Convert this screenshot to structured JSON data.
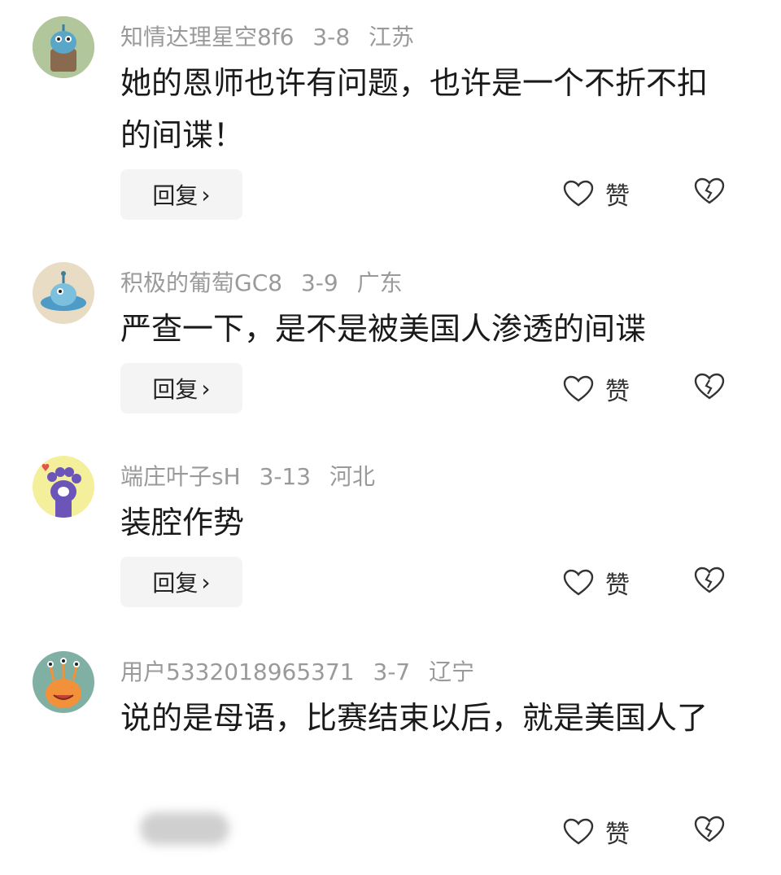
{
  "comments": [
    {
      "username": "知情达理星空8f6",
      "date": "3-8",
      "location": "江苏",
      "text": "她的恩师也许有问题，也许是一个不折不扣的间谍！",
      "reply_label": "回复",
      "like_label": "赞",
      "avatar_icon": "alien-plant-pot-avatar"
    },
    {
      "username": "积极的葡萄GC8",
      "date": "3-9",
      "location": "广东",
      "text": "严查一下，是不是被美国人渗透的间谍",
      "reply_label": "回复",
      "like_label": "赞",
      "avatar_icon": "alien-ufo-avatar"
    },
    {
      "username": "端庄叶子sH",
      "date": "3-13",
      "location": "河北",
      "text": "装腔作势",
      "reply_label": "回复",
      "like_label": "赞",
      "avatar_icon": "cat-paw-avatar"
    },
    {
      "username": "用户5332018965371",
      "date": "3-7",
      "location": "辽宁",
      "text": "说的是母语，比赛结束以后，就是美国人了",
      "reply_label": "",
      "like_label": "赞",
      "avatar_icon": "orange-monster-avatar"
    }
  ],
  "colors": {
    "meta_text": "#9a9a9a",
    "body_text": "#1a1a1a",
    "reply_bg": "#f4f4f4"
  }
}
